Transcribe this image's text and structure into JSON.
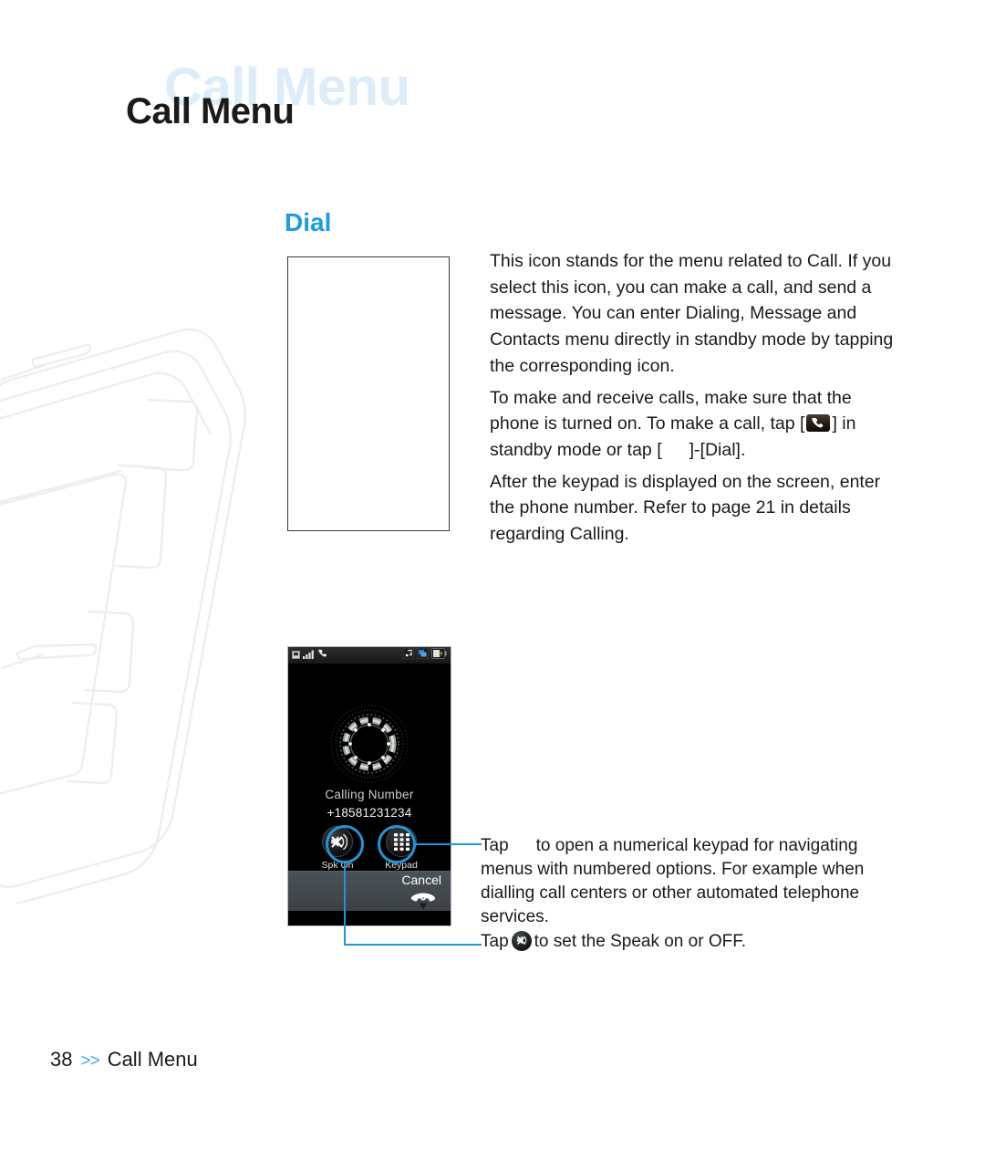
{
  "page": {
    "title_ghost": "Call Menu",
    "title_main": "Call Menu",
    "section_heading": "Dial"
  },
  "body": {
    "paragraph_1": "This icon stands for the menu related to Call. If you select this icon, you can make a call, and send a message. You can enter Dialing, Message and Contacts menu directly in standby mode by tapping the corresponding icon.",
    "paragraph_2_part1": "To make and receive calls, make sure that the phone is turned on. To make a call, tap [",
    "paragraph_2_part2": "] in standby mode or tap [",
    "paragraph_2_part3": "]-[Dial].",
    "paragraph_3": "After the keypad is displayed on the screen, enter the phone number. Refer to page 21 in details regarding Calling."
  },
  "device": {
    "status_icons_left": [
      "message-icon",
      "signal-bars-icon",
      "handset-icon"
    ],
    "status_icons_right": [
      "music-note-icon",
      "multitask-icon",
      "battery-charging-icon"
    ],
    "calling_label": "Calling Number",
    "calling_number": "+18581231234",
    "buttons": [
      {
        "label": "Spk On",
        "icon": "speaker-mute-icon"
      },
      {
        "label": "Keypad",
        "icon": "keypad-grid-icon"
      }
    ],
    "cancel_label": "Cancel",
    "cancel_icon": "end-call-icon"
  },
  "annotations": {
    "note_1_prefix": "Tap",
    "note_1_text": "to open a numerical keypad for navigating menus with numbered options. For example when dialling call centers or other automated telephone services.",
    "note_2_prefix": "Tap",
    "note_2_text": "to set the Speak on or OFF."
  },
  "footer": {
    "page_number": "38",
    "chevrons": ">>",
    "section": "Call Menu"
  },
  "colors": {
    "accent_blue": "#1b9de0",
    "annotation_blue": "#2196d6",
    "ghost_title": "#dcecfa",
    "footer_chevron": "#45a8e0"
  }
}
